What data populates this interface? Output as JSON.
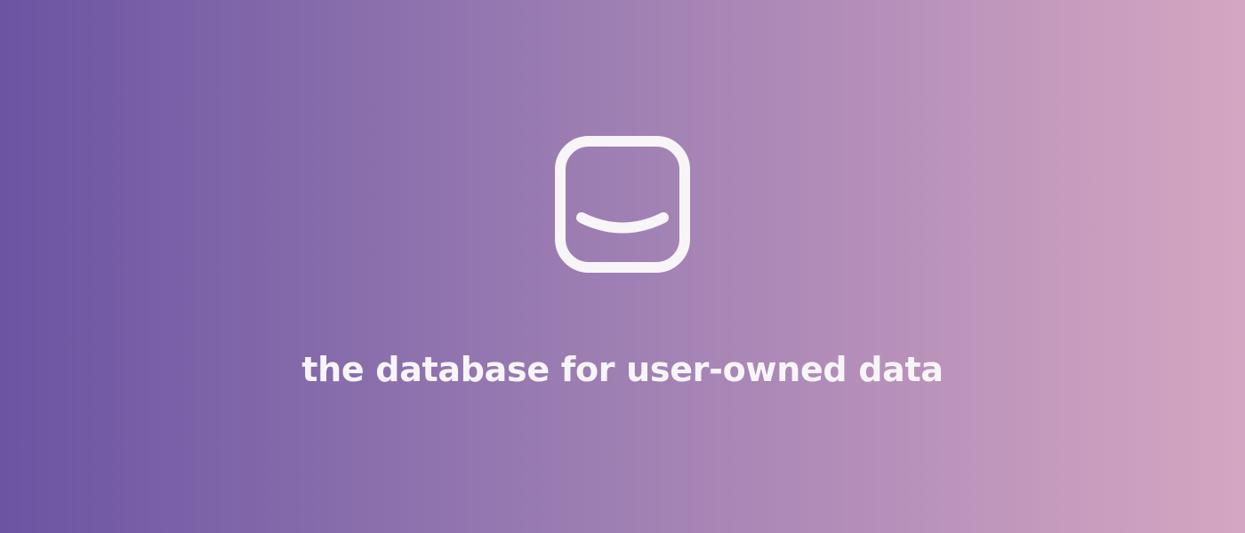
{
  "brand": {
    "logo_icon": "smiling-square-icon",
    "tagline": "the database for user-owned data"
  },
  "colors": {
    "gradient_start": "#6b54a2",
    "gradient_mid": "#9a7cb2",
    "gradient_end": "#d5a6c2",
    "foreground": "#f8f5f9"
  }
}
